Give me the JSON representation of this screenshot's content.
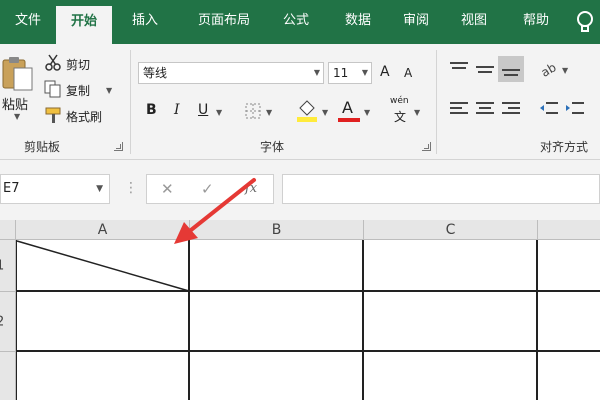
{
  "tabs": [
    "文件",
    "开始",
    "插入",
    "页面布局",
    "公式",
    "数据",
    "审阅",
    "视图",
    "帮助"
  ],
  "clipboard": {
    "paste_label": "粘贴",
    "cut_label": "剪切",
    "copy_label": "复制",
    "format_painter_label": "格式刷",
    "group_label": "剪贴板"
  },
  "font": {
    "font_name": "等线",
    "font_size": "11",
    "bold_label": "B",
    "italic_label": "I",
    "underline_label": "U",
    "font_color_label": "A",
    "wen_label": "wén",
    "wen_char": "文",
    "increase_label": "A",
    "decrease_label": "A",
    "group_label": "字体"
  },
  "alignment": {
    "group_label": "对齐方式"
  },
  "formula_bar": {
    "name_box": "E7",
    "fx_label": "fx",
    "formula_value": ""
  },
  "grid": {
    "columns": [
      "A",
      "B",
      "C"
    ],
    "rows": [
      "1",
      "2"
    ]
  },
  "colors": {
    "ribbon_green": "#217346",
    "font_color_red": "#e02020",
    "highlight_yellow": "#ffeb3b",
    "annotation_arrow": "#e53935"
  },
  "icons": [
    "paste-icon",
    "cut-icon",
    "copy-icon",
    "format-painter-icon",
    "border-icon",
    "fill-color-icon",
    "font-color-icon",
    "phonetic-icon",
    "align-icons",
    "orientation-icon",
    "indent-icons",
    "help-bulb-icon",
    "cancel-icon",
    "enter-icon",
    "insert-function-icon"
  ]
}
